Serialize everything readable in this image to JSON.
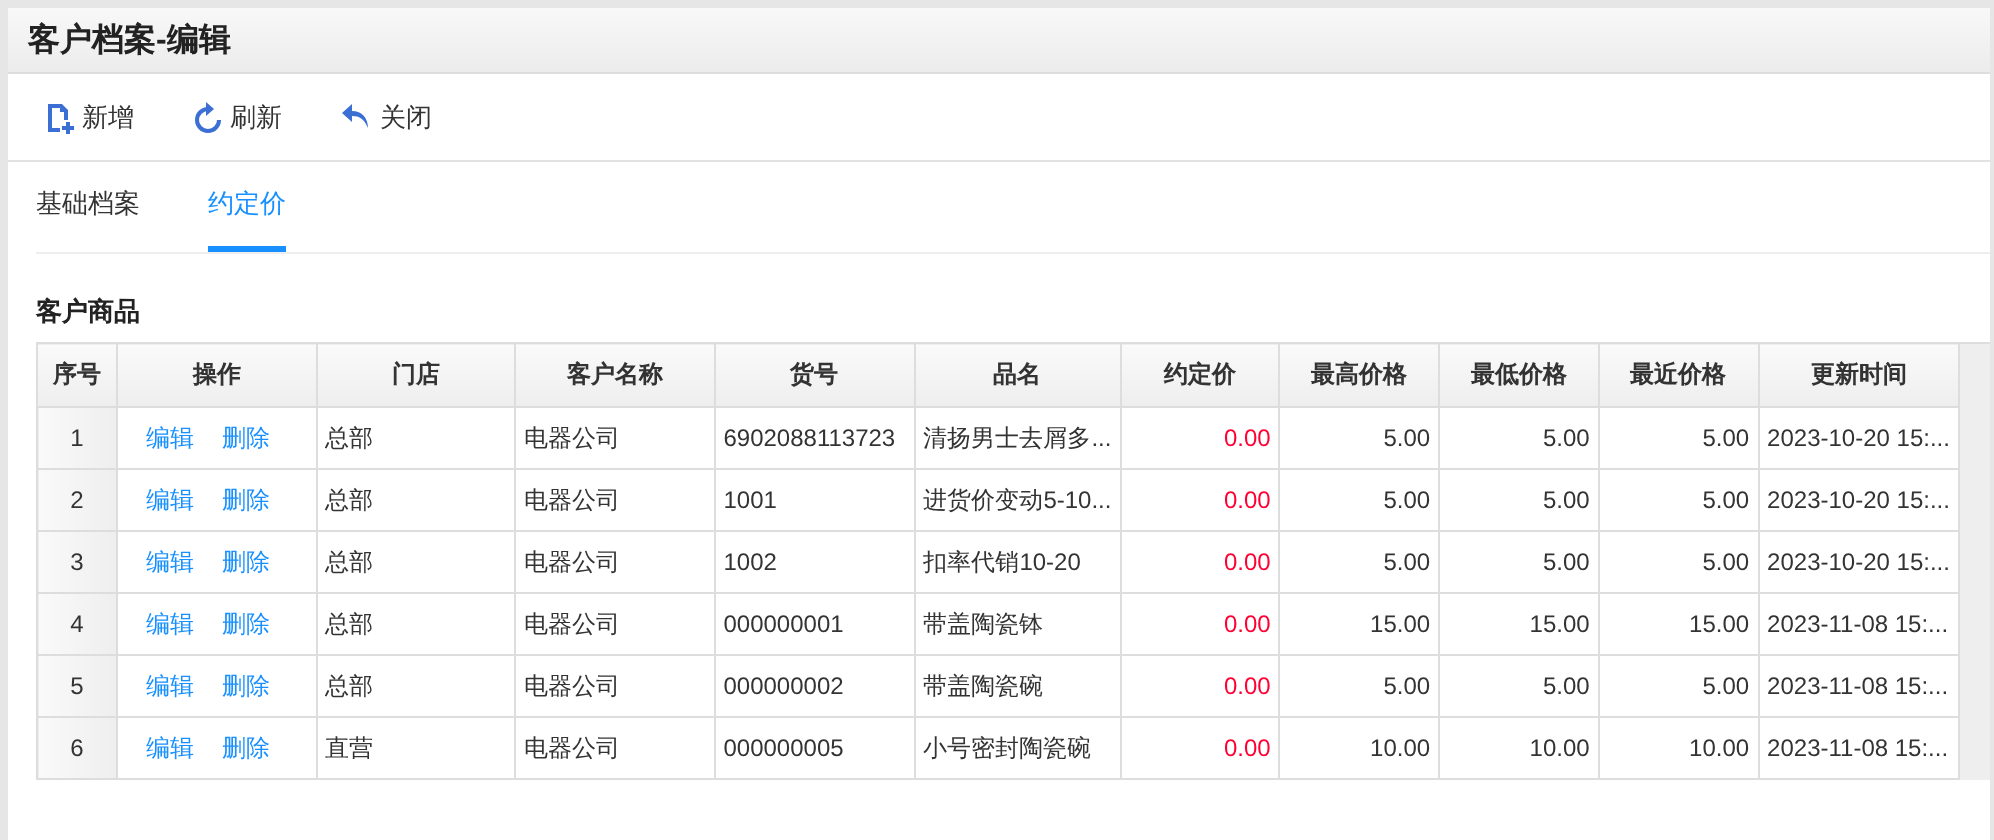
{
  "window": {
    "title": "客户档案-编辑"
  },
  "toolbar": [
    {
      "kind": "add",
      "label": "新增"
    },
    {
      "kind": "refresh",
      "label": "刷新"
    },
    {
      "kind": "close",
      "label": "关闭"
    }
  ],
  "tabs": [
    {
      "label": "基础档案",
      "selected": false
    },
    {
      "label": "约定价",
      "selected": true
    }
  ],
  "section_title": "客户商品",
  "table": {
    "columns": [
      "序号",
      "操作",
      "门店",
      "客户名称",
      "货号",
      "品名",
      "约定价",
      "最高价格",
      "最低价格",
      "最近价格",
      "更新时间"
    ],
    "rows": [
      {
        "index": "1",
        "actions": [
          "编辑",
          "删除"
        ],
        "store": "总部",
        "customer": "电器公司",
        "code": "6902088113723",
        "name": "清扬男士去屑多...",
        "agreed": "0.00",
        "max": "5.00",
        "min": "5.00",
        "recent": "5.00",
        "updated": "2023-10-20 15:..."
      },
      {
        "index": "2",
        "actions": [
          "编辑",
          "删除"
        ],
        "store": "总部",
        "customer": "电器公司",
        "code": "1001",
        "name": "进货价变动5-10...",
        "agreed": "0.00",
        "max": "5.00",
        "min": "5.00",
        "recent": "5.00",
        "updated": "2023-10-20 15:..."
      },
      {
        "index": "3",
        "actions": [
          "编辑",
          "删除"
        ],
        "store": "总部",
        "customer": "电器公司",
        "code": "1002",
        "name": "扣率代销10-20",
        "agreed": "0.00",
        "max": "5.00",
        "min": "5.00",
        "recent": "5.00",
        "updated": "2023-10-20 15:..."
      },
      {
        "index": "4",
        "actions": [
          "编辑",
          "删除"
        ],
        "store": "总部",
        "customer": "电器公司",
        "code": "000000001",
        "name": "带盖陶瓷钵",
        "agreed": "0.00",
        "max": "15.00",
        "min": "15.00",
        "recent": "15.00",
        "updated": "2023-11-08 15:..."
      },
      {
        "index": "5",
        "actions": [
          "编辑",
          "删除"
        ],
        "store": "总部",
        "customer": "电器公司",
        "code": "000000002",
        "name": "带盖陶瓷碗",
        "agreed": "0.00",
        "max": "5.00",
        "min": "5.00",
        "recent": "5.00",
        "updated": "2023-11-08 15:..."
      },
      {
        "index": "6",
        "actions": [
          "编辑",
          "删除"
        ],
        "store": "直营",
        "customer": "电器公司",
        "code": "000000005",
        "name": "小号密封陶瓷碗",
        "agreed": "0.00",
        "max": "10.00",
        "min": "10.00",
        "recent": "10.00",
        "updated": "2023-11-08 15:..."
      }
    ]
  }
}
